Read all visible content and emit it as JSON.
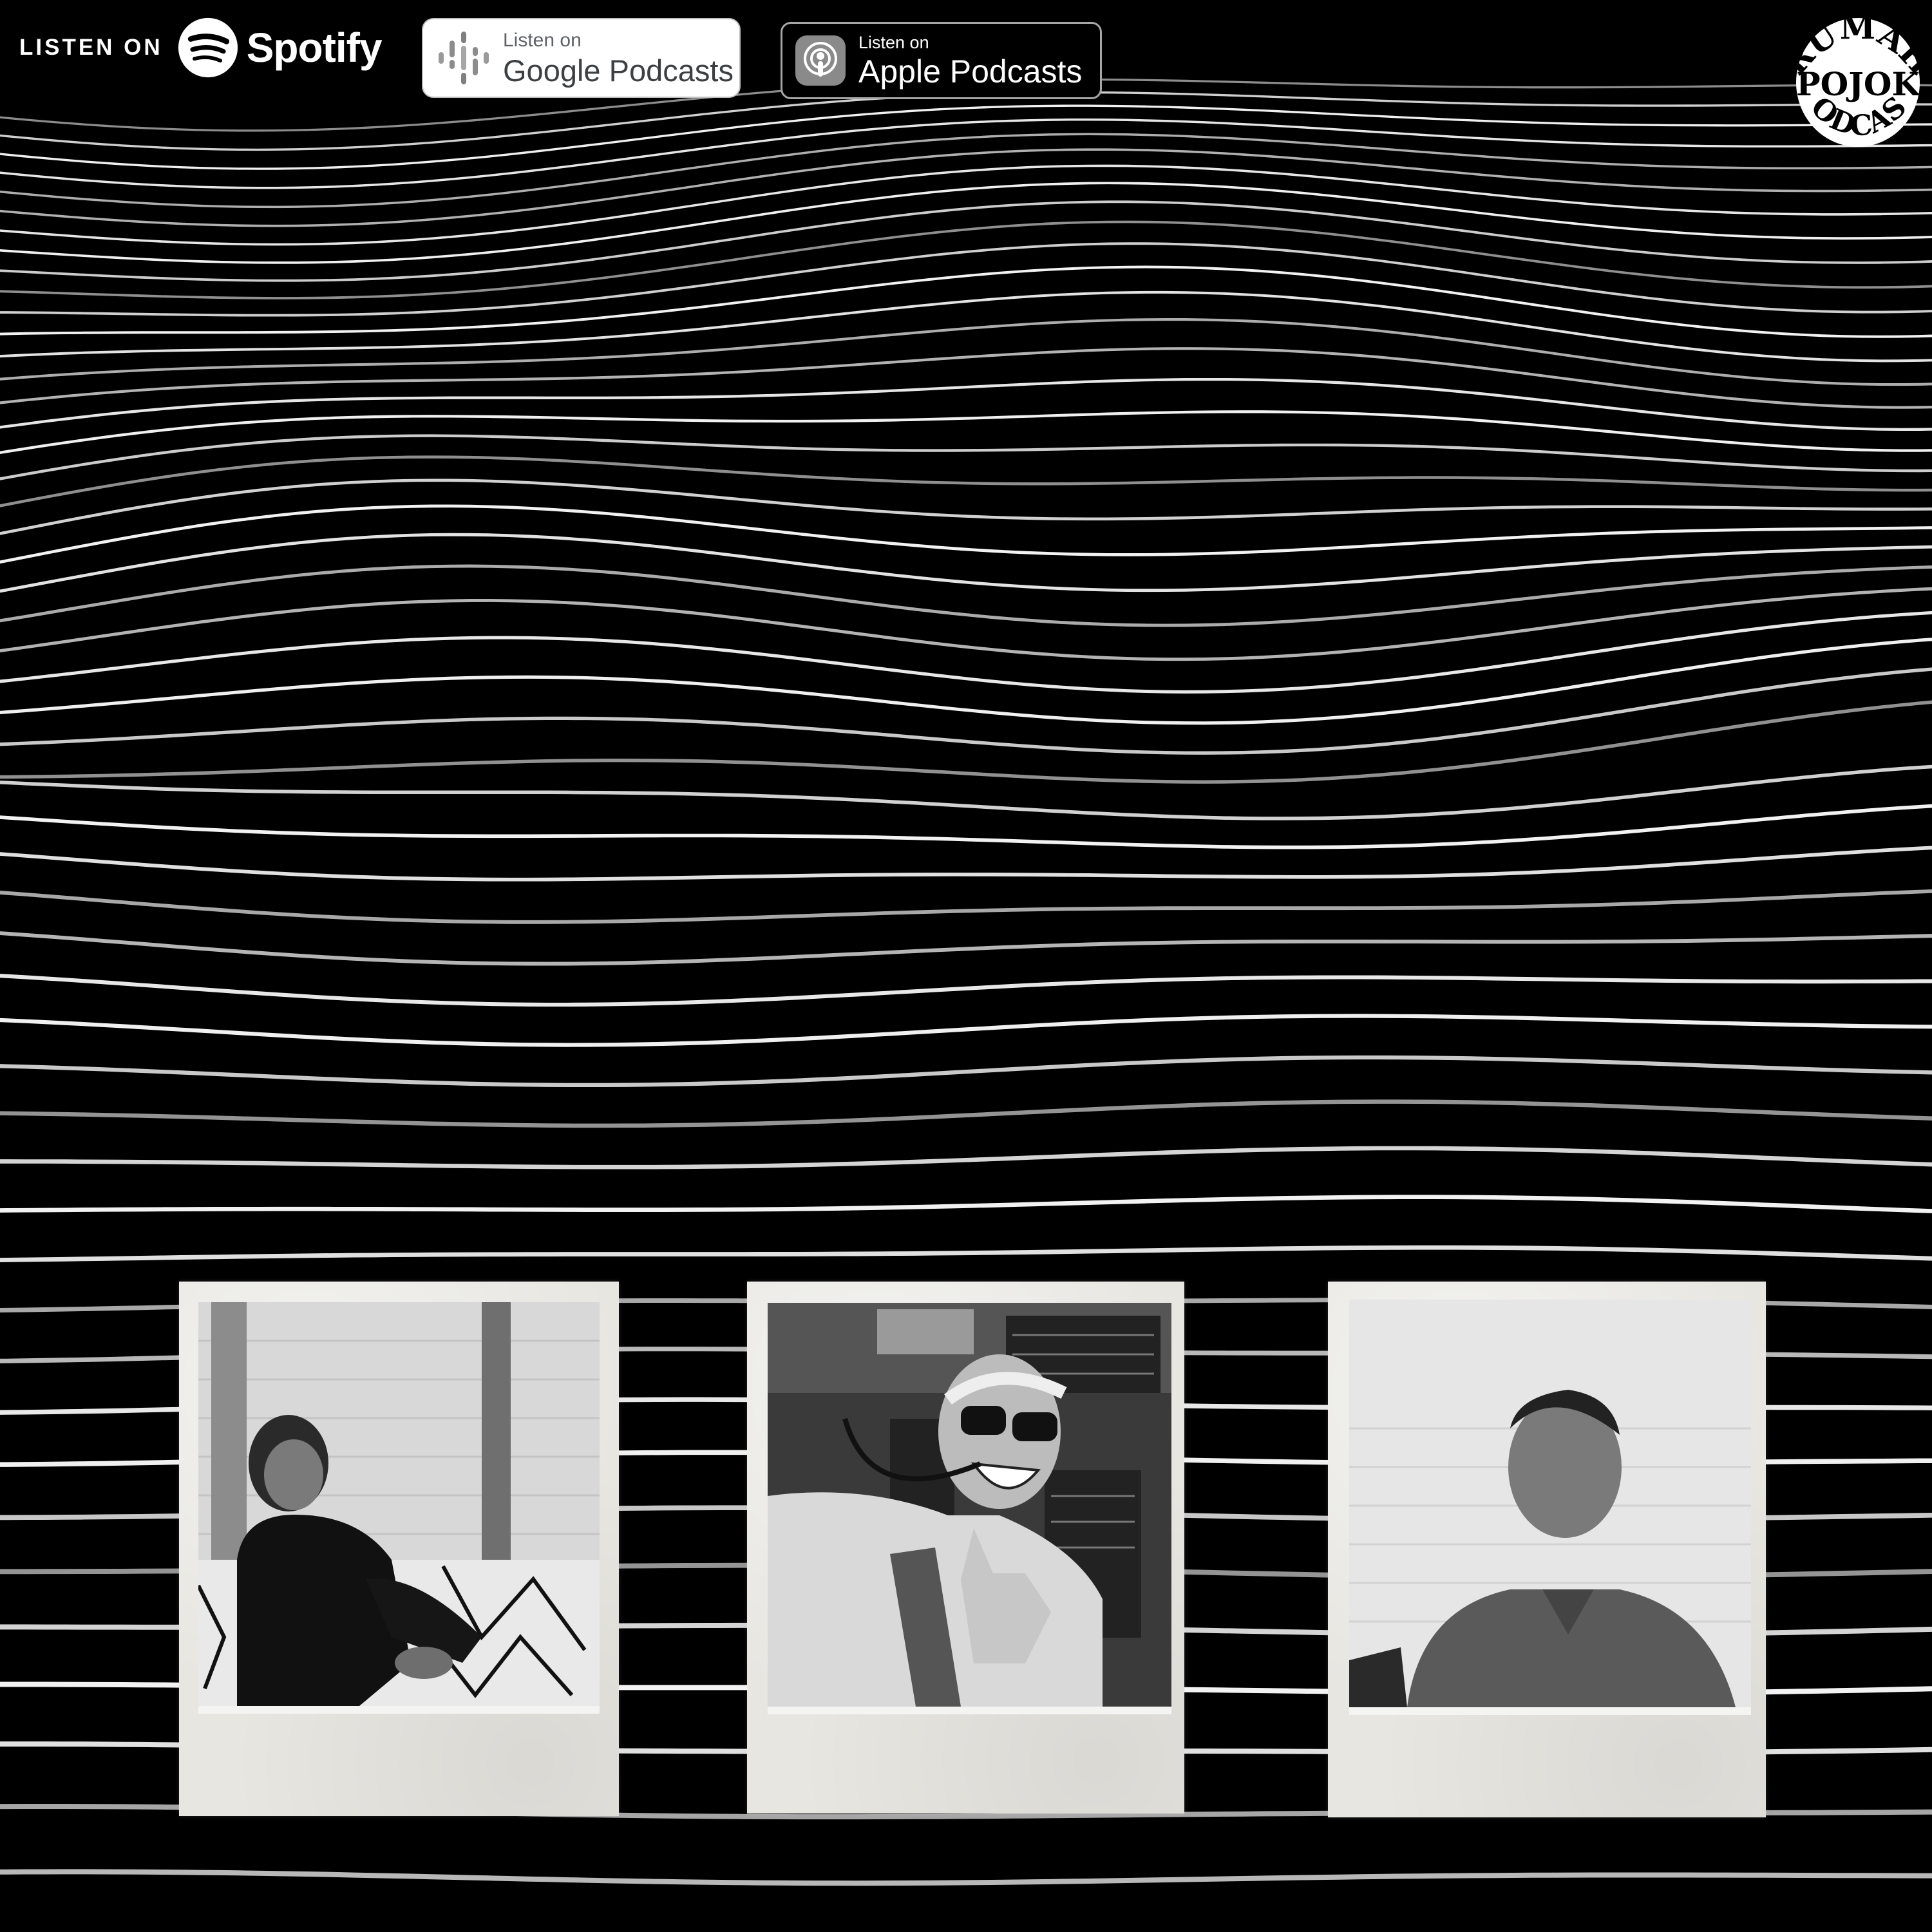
{
  "badges": {
    "spotify": {
      "prefix": "LISTEN ON",
      "brand": "Spotify",
      "icon": "spotify-logo-icon"
    },
    "google_podcasts": {
      "small": "Listen on",
      "big": "Google Podcasts",
      "icon": "google-podcasts-icon"
    },
    "apple_podcasts": {
      "small": "Listen on",
      "big": "Apple Podcasts",
      "icon": "apple-podcasts-icon"
    }
  },
  "logo": {
    "text": "RUMAH POJOK PODCAST",
    "icon": "podcast-seal-logo"
  },
  "photos": [
    {
      "subject": "man with glasses seated on patterned sofa"
    },
    {
      "subject": "pilot in sunglasses and headset in cockpit"
    },
    {
      "subject": "man in collared shirt against white brick wall"
    }
  ],
  "colors": {
    "background": "#000000",
    "wave_lines": "#ffffff",
    "polaroid_frame": "#e7e6e1"
  }
}
